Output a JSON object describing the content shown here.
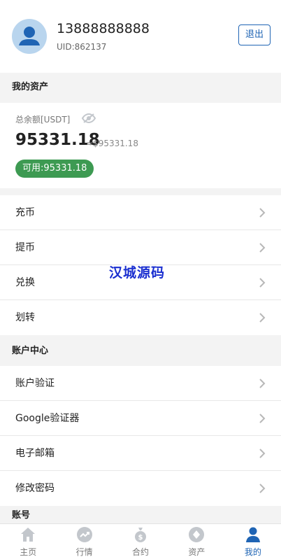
{
  "profile": {
    "phone": "13888888888",
    "uid": "UID:862137",
    "logout_label": "退出"
  },
  "assets": {
    "section_title": "我的资产",
    "total_label": "总余额[USDT]",
    "balance": "95331.18",
    "approx": "≈$95331.18",
    "available": "可用:95331.18"
  },
  "asset_actions": [
    {
      "label": "充币"
    },
    {
      "label": "提币"
    },
    {
      "label": "兑换"
    },
    {
      "label": "划转"
    }
  ],
  "account_center": {
    "section_title": "账户中心",
    "items": [
      {
        "label": "账户验证"
      },
      {
        "label": "Google验证器"
      },
      {
        "label": "电子邮箱"
      },
      {
        "label": "修改密码"
      }
    ]
  },
  "account_section_title": "账号",
  "watermark": "汉城源码",
  "tabs": [
    {
      "label": "主页",
      "icon": "home-icon"
    },
    {
      "label": "行情",
      "icon": "trend-icon"
    },
    {
      "label": "合约",
      "icon": "money-bag-icon"
    },
    {
      "label": "资产",
      "icon": "diamond-icon"
    },
    {
      "label": "我的",
      "icon": "user-icon",
      "active": true
    }
  ],
  "colors": {
    "accent": "#1f64b4",
    "available_badge": "#3d9a52",
    "inactive_icon": "#c3c7cc"
  }
}
